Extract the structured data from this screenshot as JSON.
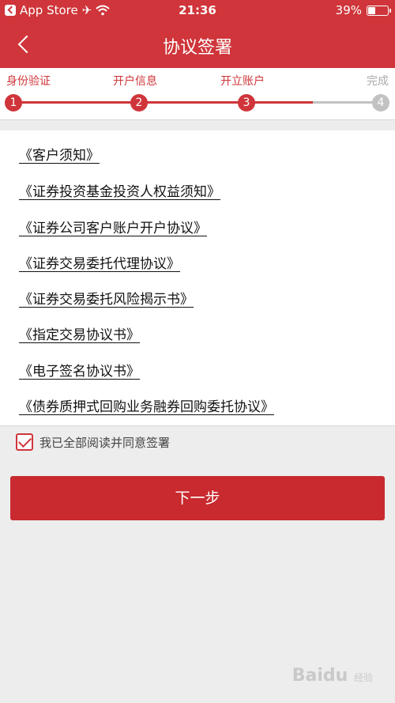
{
  "status_bar": {
    "back_app": "App Store",
    "time": "21:36",
    "battery": "39%",
    "battery_level": 0.39
  },
  "nav": {
    "title": "协议签署"
  },
  "steps": [
    {
      "label": "身份验证",
      "number": "1",
      "active": true
    },
    {
      "label": "开户信息",
      "number": "2",
      "active": true
    },
    {
      "label": "开立账户",
      "number": "3",
      "active": true
    },
    {
      "label": "完成",
      "number": "4",
      "active": false
    }
  ],
  "agreements": [
    "《客户须知》",
    "《证券投资基金投资人权益须知》",
    "《证券公司客户账户开户协议》",
    "《证券交易委托代理协议》",
    "《证券交易委托风险揭示书》",
    "《指定交易协议书》",
    "《电子签名协议书》",
    "《债券质押式回购业务融券回购委托协议》"
  ],
  "agree": {
    "checked": true,
    "label": "我已全部阅读并同意签署"
  },
  "next_button": "下一步",
  "watermark": {
    "brand": "Bai du",
    "sub": "经验"
  },
  "colors": {
    "brand_red": "#cf353a",
    "inactive_gray": "#c2c2c2"
  }
}
